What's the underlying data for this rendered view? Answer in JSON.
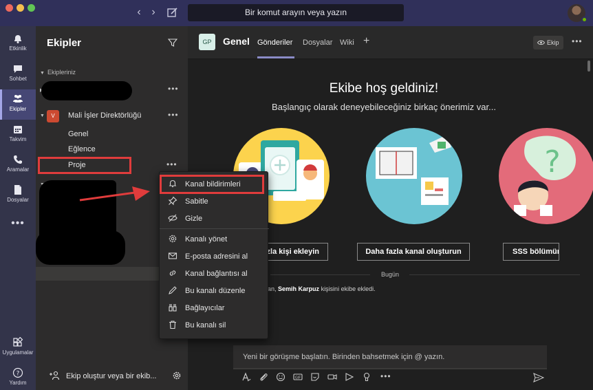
{
  "titlebar": {
    "search_placeholder": "Bir komut arayın veya yazın",
    "back": "‹",
    "forward": "›"
  },
  "rail": {
    "items": [
      {
        "label": "Etkinlik",
        "icon": "bell-icon"
      },
      {
        "label": "Sohbet",
        "icon": "chat-icon"
      },
      {
        "label": "Ekipler",
        "icon": "teams-icon",
        "active": true
      },
      {
        "label": "Takvim",
        "icon": "calendar-icon"
      },
      {
        "label": "Aramalar",
        "icon": "phone-icon"
      },
      {
        "label": "Dosyalar",
        "icon": "file-icon"
      }
    ],
    "more": "•••",
    "bottom": [
      {
        "label": "Uygulamalar",
        "icon": "apps-icon"
      },
      {
        "label": "Yardım",
        "icon": "help-icon"
      }
    ]
  },
  "panel": {
    "title": "Ekipler",
    "section": "Ekipleriniz",
    "team_avatar": "V",
    "team_name": "Mali İşler Direktörlüğü",
    "channels": [
      "Genel",
      "Eğlence",
      "Proje"
    ],
    "dots": "•••",
    "footer": "Ekip oluştur veya bir ekib..."
  },
  "main": {
    "channel_avatar": "GP",
    "channel_title": "Genel",
    "tabs": [
      "Gönderiler",
      "Dosyalar",
      "Wiki"
    ],
    "tab_add": "+",
    "team_button": "Ekip",
    "welcome": "Ekibe hoş geldiniz!",
    "subtitle": "Başlangıç olarak deneyebileceğiniz birkaç önerimiz var...",
    "actions": [
      "fazla kişi ekleyin",
      "Daha fazla kanal oluşturun",
      "SSS bölümün"
    ],
    "today": "Bugün",
    "activity_prefix": "an,",
    "activity_name": "Semih Karpuz",
    "activity_suffix": "kişisini ekibe ekledi.",
    "compose_placeholder": "Yeni bir görüşme başlatın. Birinden bahsetmek için @ yazın."
  },
  "menu": {
    "items": [
      {
        "label": "Kanal bildirimleri",
        "icon": "bell-icon"
      },
      {
        "label": "Sabitle",
        "icon": "pin-icon"
      },
      {
        "label": "Gizle",
        "icon": "hide-icon"
      },
      {
        "label": "Kanalı yönet",
        "icon": "gear-icon"
      },
      {
        "label": "E-posta adresini al",
        "icon": "mail-icon"
      },
      {
        "label": "Kanal bağlantısı al",
        "icon": "link-icon"
      },
      {
        "label": "Bu kanalı düzenle",
        "icon": "pencil-icon"
      },
      {
        "label": "Bağlayıcılar",
        "icon": "connector-icon"
      },
      {
        "label": "Bu kanalı sil",
        "icon": "trash-icon"
      }
    ]
  },
  "colors": {
    "accent": "#8b8cc7",
    "highlight": "#e03c3c",
    "rail": "#33344a"
  }
}
